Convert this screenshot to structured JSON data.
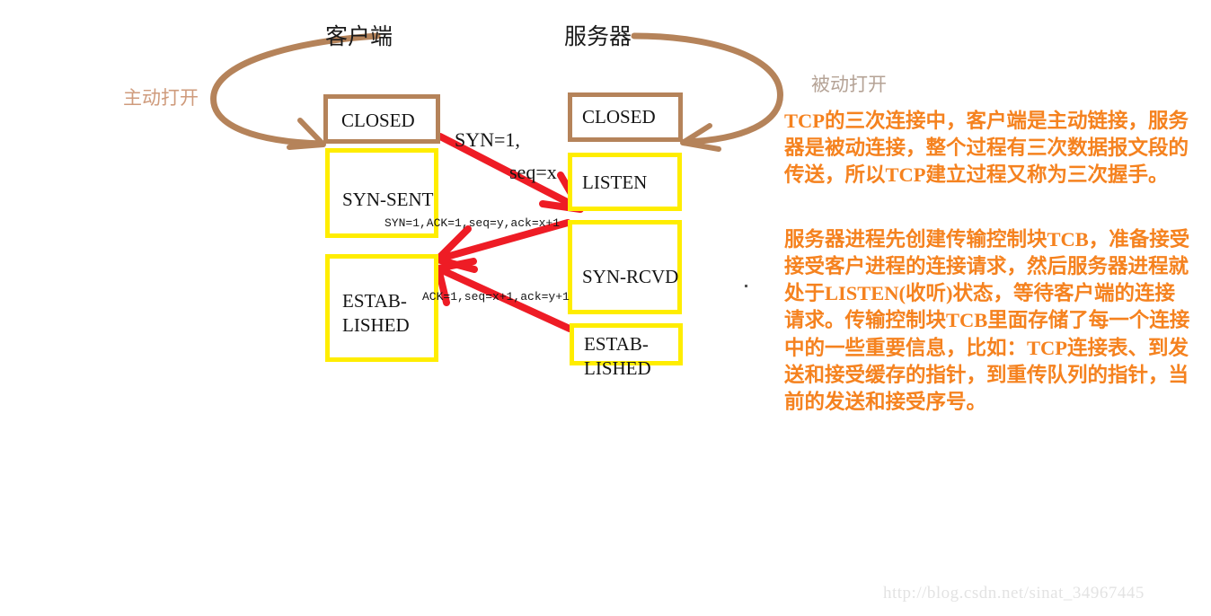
{
  "diagram": {
    "title_client": "客户端",
    "title_server": "服务器",
    "active_open_label": "主动打开",
    "passive_open_label": "被动打开",
    "client_states": [
      {
        "name": "CLOSED",
        "lines": [
          "CLOSED"
        ],
        "color": "#b5835a"
      },
      {
        "name": "SYN-SENT",
        "lines": [
          "SYN-SENT"
        ],
        "color": "#ffed00"
      },
      {
        "name": "ESTABLISHED",
        "lines": [
          "ESTAB-",
          "LISHED"
        ],
        "color": "#ffed00"
      }
    ],
    "server_states": [
      {
        "name": "CLOSED",
        "lines": [
          "CLOSED"
        ],
        "color": "#b5835a"
      },
      {
        "name": "LISTEN",
        "lines": [
          "LISTEN"
        ],
        "color": "#ffed00"
      },
      {
        "name": "SYN-RCVD",
        "lines": [
          "SYN-RCVD"
        ],
        "color": "#ffed00"
      },
      {
        "name": "ESTABLISHED",
        "lines": [
          "ESTAB-",
          "LISHED"
        ],
        "color": "#ffed00"
      }
    ],
    "messages": [
      {
        "id": "syn",
        "line1": "SYN=1,",
        "line2": "seq=x",
        "direction": "client-to-server"
      },
      {
        "id": "synack",
        "text": "SYN=1,ACK=1,seq=y,ack=x+1",
        "direction": "server-to-client"
      },
      {
        "id": "ack",
        "text": "ACK=1,seq=x+1,ack=y+1",
        "direction": "server-to-client"
      }
    ],
    "arrow_color": "#ee1c25",
    "curve_color": "#b5835a"
  },
  "note": {
    "paragraph1": "TCP的三次连接中，客户端是主动链接，服务器是被动连接，整个过程有三次数据报文段的传送，所以TCP建立过程又称为三次握手。",
    "paragraph2": "服务器进程先创建传输控制块TCB，准备接受接受客户进程的连接请求，然后服务器进程就处于LISTEN(收听)状态，等待客户端的连接请求。传输控制块TCB里面存储了每一个连接中的一些重要信息，比如：TCP连接表、到发送和接受缓存的指针，到重传队列的指针，当前的发送和接受序号。",
    "color": "#f5821f"
  },
  "watermark": {
    "text": "http://blog.csdn.net/sinat_34967445"
  }
}
